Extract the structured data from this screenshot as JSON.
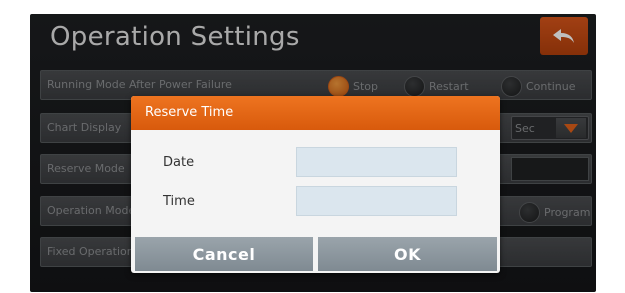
{
  "header": {
    "title": "Operation Settings"
  },
  "rows": [
    {
      "label": "Running Mode After Power Failure",
      "options": [
        {
          "label": "Stop",
          "selected": true
        },
        {
          "label": "Restart",
          "selected": false
        },
        {
          "label": "Continue",
          "selected": false
        }
      ]
    },
    {
      "label": "Chart Display",
      "value": "Sec"
    },
    {
      "label": "Reserve Mode"
    },
    {
      "label": "Operation Mode",
      "option": "Program"
    },
    {
      "label": "Fixed Operation"
    }
  ],
  "dialog": {
    "title": "Reserve Time",
    "date_label": "Date",
    "date_value": "",
    "time_label": "Time",
    "time_value": "",
    "cancel_label": "Cancel",
    "ok_label": "OK"
  },
  "colors": {
    "accent": "#e3651a",
    "dialog_button": "#8c969d",
    "input_fill": "#dbe6ee"
  }
}
